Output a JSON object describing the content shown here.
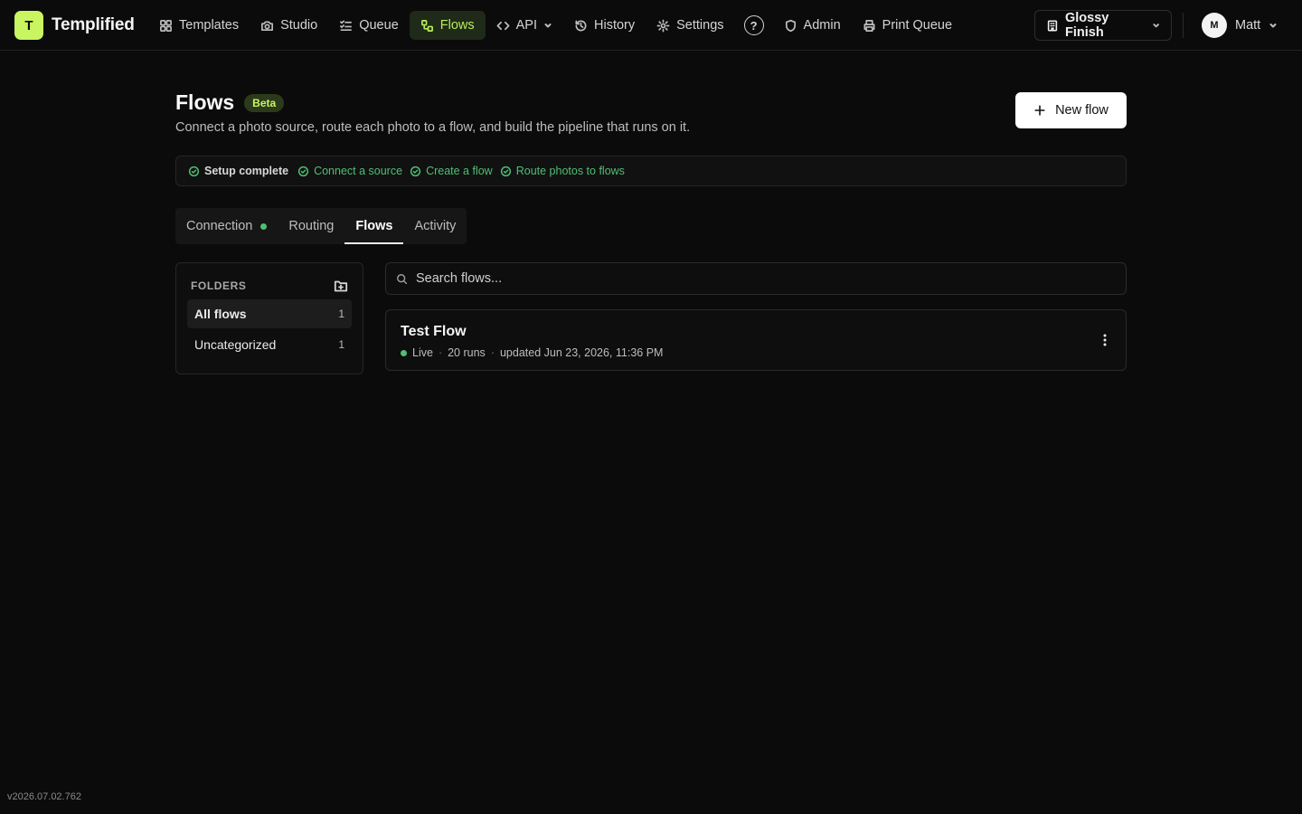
{
  "app": {
    "logo_letter": "T",
    "name": "Templified",
    "accent": "#c8f560"
  },
  "nav": {
    "items": [
      {
        "label": "Templates",
        "icon": "grid-icon"
      },
      {
        "label": "Studio",
        "icon": "camera-icon"
      },
      {
        "label": "Queue",
        "icon": "list-check-icon"
      },
      {
        "label": "Flows",
        "icon": "workflow-icon",
        "active": true
      },
      {
        "label": "API",
        "icon": "code-icon",
        "dropdown": true
      },
      {
        "label": "History",
        "icon": "history-icon"
      },
      {
        "label": "Settings",
        "icon": "gear-icon"
      },
      {
        "label": "?",
        "icon": "help-icon"
      },
      {
        "label": "Admin",
        "icon": "shield-icon"
      },
      {
        "label": "Print Queue",
        "icon": "printer-icon"
      }
    ]
  },
  "workspace": {
    "label": "Glossy Finish",
    "icon": "building-icon"
  },
  "user": {
    "initial": "M",
    "name": "Matt"
  },
  "header": {
    "title": "Flows",
    "badge": "Beta",
    "subtitle": "Connect a photo source, route each photo to a flow, and build the pipeline that runs on it.",
    "new_button": "New flow"
  },
  "setup": {
    "status": "Setup complete",
    "steps": [
      "Connect a source",
      "Create a flow",
      "Route photos to flows"
    ],
    "color": "#4fbf74"
  },
  "tabs": [
    {
      "label": "Connection",
      "status_dot": true
    },
    {
      "label": "Routing"
    },
    {
      "label": "Flows",
      "active": true
    },
    {
      "label": "Activity"
    }
  ],
  "folders": {
    "heading": "FOLDERS",
    "items": [
      {
        "label": "All flows",
        "count": "1",
        "active": true
      },
      {
        "label": "Uncategorized",
        "count": "1"
      }
    ]
  },
  "search": {
    "placeholder": "Search flows...",
    "value": ""
  },
  "flows": [
    {
      "name": "Test Flow",
      "status": "Live",
      "runs": "20 runs",
      "updated": "updated Jun 23, 2026, 11:36 PM"
    }
  ],
  "version": "v2026.07.02.762"
}
